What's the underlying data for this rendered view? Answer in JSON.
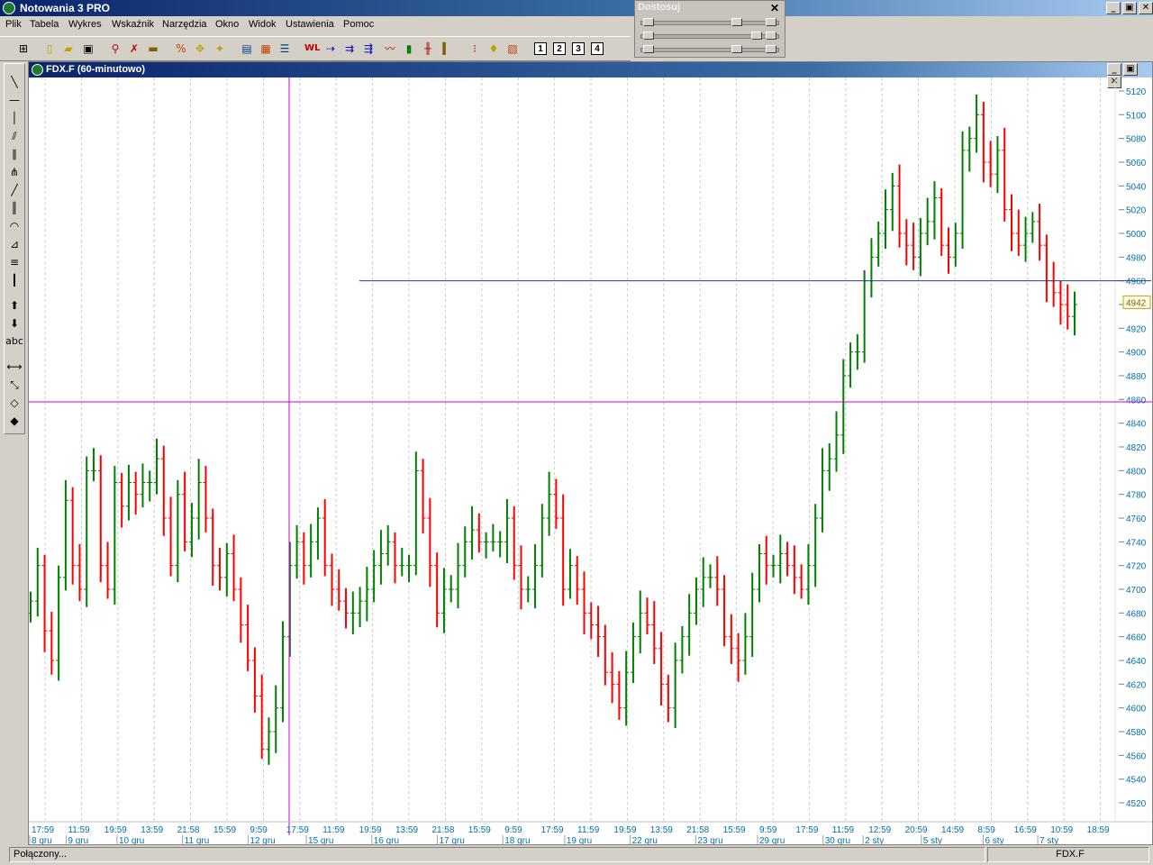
{
  "app": {
    "title": "Notowania 3 PRO"
  },
  "window_buttons": {
    "minimize": "_",
    "restore": "▣",
    "close": "✕"
  },
  "menu": [
    "Plik",
    "Tabela",
    "Wykres",
    "Wskaźnik",
    "Narzędzia",
    "Okno",
    "Widok",
    "Ustawienia",
    "Pomoc"
  ],
  "toolbar": {
    "icons": [
      "grid-icon",
      "new-file-icon",
      "open-folder-icon",
      "save-icon",
      "search-icon",
      "delete-icon",
      "ruler-icon",
      "percent-icon",
      "cursor-icon",
      "cursor-alt-icon",
      "table-icon",
      "table-color-icon",
      "table-list-icon",
      "w-l-icon",
      "arrow-right-blue-icon",
      "arrow-right-double-icon",
      "arrow-right-triple-icon",
      "line-chart-icon",
      "bar-chart-icon",
      "ohlc-icon",
      "candle-icon",
      "traffic-light-icon",
      "pin-icon",
      "picture-icon"
    ],
    "numbered": [
      "1",
      "2",
      "3",
      "4"
    ]
  },
  "adjust_panel": {
    "title": "Dostosuj",
    "close": "✕",
    "levels": [
      0.72,
      0.88,
      0.72
    ]
  },
  "left_tools": {
    "icons": [
      "trend-line-icon",
      "horizontal-line-icon",
      "vertical-line-icon",
      "channel-icon",
      "parallel-lines-icon",
      "fan-icon",
      "ray-icon",
      "vertical-lines-icon",
      "arc-icon",
      "fibonacci-fan-icon",
      "fibonacci-retracement-icon",
      "time-zones-icon",
      "arrow-up-icon",
      "arrow-down-icon",
      "text-tool-icon",
      "resize-horizontal-icon",
      "zoom-icon",
      "eraser-icon",
      "eraser-all-icon"
    ],
    "text_label": "abc"
  },
  "chart_window": {
    "title": "FDX.F (60-minutowo)"
  },
  "status": {
    "left": "Połączony...",
    "right": "FDX.F"
  },
  "colors": {
    "up": "#008000",
    "down": "#ff0000",
    "axis_text": "#0070b0",
    "crosshair": "#cc00cc",
    "hline": "#1f3f8f",
    "grid": "#c8c8c8"
  },
  "chart_data": {
    "type": "ohlc",
    "ylim": [
      4510,
      5130
    ],
    "y_ticks": [
      4520,
      4540,
      4560,
      4580,
      4600,
      4620,
      4640,
      4660,
      4680,
      4700,
      4720,
      4740,
      4760,
      4780,
      4800,
      4820,
      4840,
      4860,
      4880,
      4900,
      4920,
      4940,
      4960,
      4980,
      5000,
      5020,
      5040,
      5060,
      5080,
      5100,
      5120
    ],
    "last_price": "4942",
    "horizontal_line": 4960,
    "crosshair_price": 4858,
    "time_labels": [
      "17:59",
      "11:59",
      "19:59",
      "13:59",
      "21:58",
      "15:59",
      "9:59",
      "17:59",
      "11:59",
      "19:59",
      "13:59",
      "21:58",
      "15:59",
      "9:59",
      "17:59",
      "11:59",
      "19:59",
      "13:59",
      "21:58",
      "15:59",
      "9:59",
      "17:59",
      "11:59",
      "12:59",
      "20:59",
      "14:59",
      "8:59",
      "16:59",
      "10:59",
      "18:59"
    ],
    "date_labels": [
      {
        "text": "8 gru",
        "slot": 0
      },
      {
        "text": "9 gru",
        "slot": 1
      },
      {
        "text": "10 gru",
        "slot": 2.4
      },
      {
        "text": "11 gru",
        "slot": 4.2
      },
      {
        "text": "12 gru",
        "slot": 6
      },
      {
        "text": "15 gru",
        "slot": 7.6
      },
      {
        "text": "16 gru",
        "slot": 9.4
      },
      {
        "text": "17 gru",
        "slot": 11.2
      },
      {
        "text": "18 gru",
        "slot": 13
      },
      {
        "text": "19 gru",
        "slot": 14.7
      },
      {
        "text": "22 gru",
        "slot": 16.5
      },
      {
        "text": "23 gru",
        "slot": 18.3
      },
      {
        "text": "29 gru",
        "slot": 20
      },
      {
        "text": "30 gru",
        "slot": 21.8
      },
      {
        "text": "2 sty",
        "slot": 22.9
      },
      {
        "text": "5 sty",
        "slot": 24.5
      },
      {
        "text": "6 sty",
        "slot": 26.2
      },
      {
        "text": "7 sty",
        "slot": 27.7
      }
    ],
    "closes": [
      4690,
      4720,
      4665,
      4640,
      4710,
      4775,
      4720,
      4700,
      4800,
      4800,
      4720,
      4700,
      4790,
      4770,
      4790,
      4780,
      4790,
      4790,
      4810,
      4760,
      4720,
      4780,
      4740,
      4760,
      4790,
      4760,
      4720,
      4710,
      4730,
      4700,
      4670,
      4640,
      4610,
      4565,
      4580,
      4600,
      4660,
      4720,
      4740,
      4720,
      4740,
      4760,
      4720,
      4700,
      4690,
      4680,
      4680,
      4690,
      4700,
      4720,
      4730,
      4740,
      4720,
      4720,
      4720,
      4800,
      4760,
      4720,
      4680,
      4700,
      4700,
      4720,
      4740,
      4750,
      4740,
      4740,
      4740,
      4740,
      4760,
      4720,
      4700,
      4700,
      4720,
      4760,
      4780,
      4760,
      4700,
      4720,
      4700,
      4680,
      4670,
      4660,
      4630,
      4620,
      4600,
      4630,
      4660,
      4680,
      4670,
      4650,
      4620,
      4600,
      4640,
      4660,
      4680,
      4700,
      4710,
      4710,
      4700,
      4660,
      4650,
      4640,
      4660,
      4700,
      4730,
      4720,
      4720,
      4730,
      4720,
      4710,
      4700,
      4720,
      4760,
      4800,
      4810,
      4830,
      4880,
      4900,
      4900,
      4960,
      4980,
      5000,
      5020,
      5040,
      5000,
      4990,
      4980,
      5000,
      5010,
      5030,
      4990,
      4980,
      5000,
      5070,
      5080,
      5100,
      5060,
      5050,
      5070,
      5020,
      5000,
      4990,
      5000,
      5010,
      4990,
      4960,
      4950,
      4940,
      4930,
      4940
    ]
  }
}
